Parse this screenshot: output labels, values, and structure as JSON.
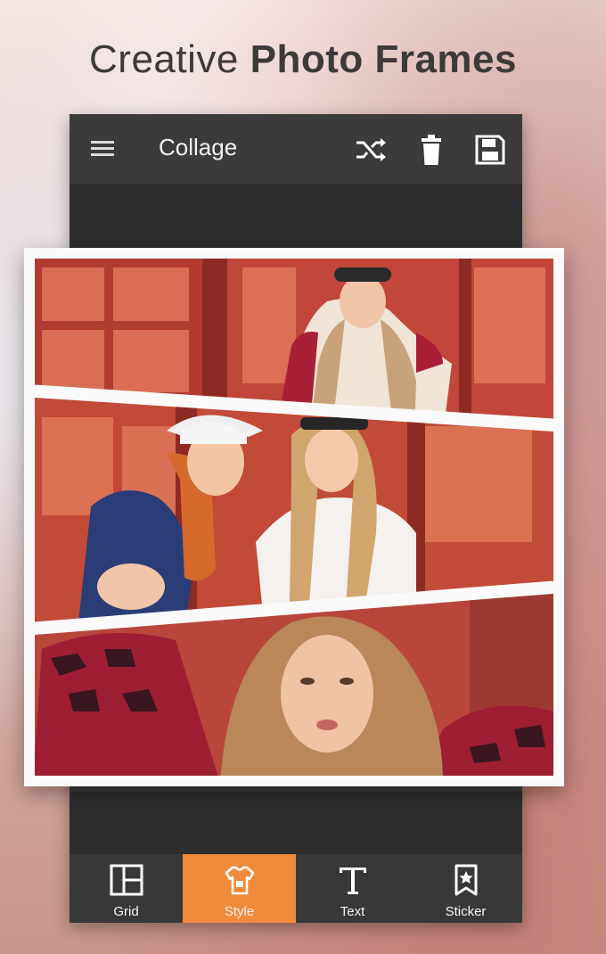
{
  "headline": {
    "light": "Creative",
    "bold": "Photo Frames"
  },
  "appbar": {
    "title": "Collage",
    "menu_icon": "hamburger-menu-icon",
    "actions": [
      {
        "name": "shuffle",
        "icon": "shuffle-icon"
      },
      {
        "name": "delete",
        "icon": "trash-icon"
      },
      {
        "name": "save",
        "icon": "save-icon"
      }
    ]
  },
  "collage": {
    "panels": [
      {
        "description": "photo-top"
      },
      {
        "description": "photo-middle"
      },
      {
        "description": "photo-bottom"
      }
    ],
    "frame_color": "#fafafa"
  },
  "bottom_nav": {
    "items": [
      {
        "label": "Grid",
        "icon": "grid-icon"
      },
      {
        "label": "Style",
        "icon": "shirt-icon",
        "active": true
      },
      {
        "label": "Text",
        "icon": "text-icon"
      },
      {
        "label": "Sticker",
        "icon": "sticker-icon"
      }
    ]
  },
  "colors": {
    "toolbar": "#3b3b3b",
    "accent": "#f08a3c",
    "headline_text": "#3d3a3a"
  }
}
